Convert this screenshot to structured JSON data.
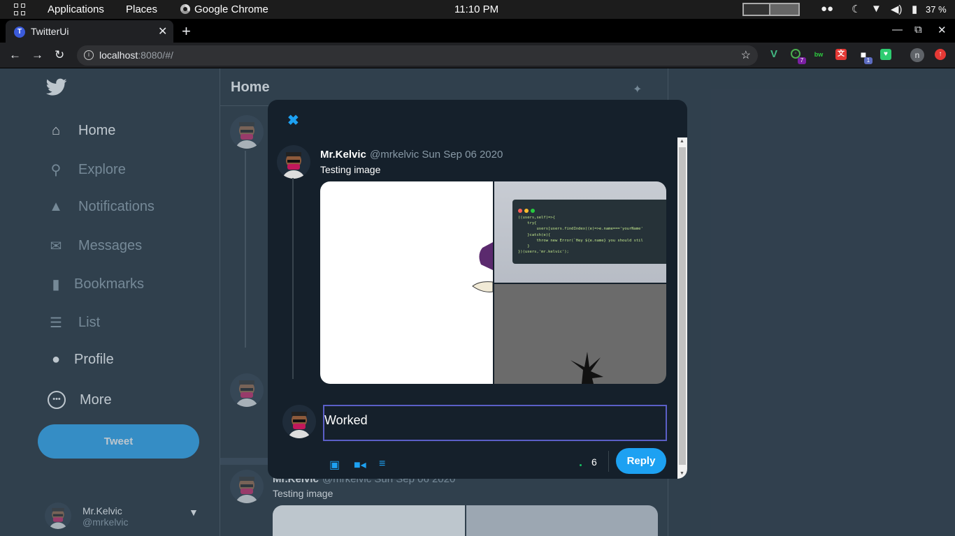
{
  "system_bar": {
    "applications": "Applications",
    "places": "Places",
    "browser": "Google Chrome",
    "clock": "11:10 PM",
    "battery": "37 %"
  },
  "browser": {
    "tab_title": "TwitterUi",
    "tab_favicon_letter": "T",
    "url_host": "localhost",
    "url_rest": ":8080/#/",
    "ext_badge_1": "7",
    "ext_badge_2": "1",
    "profile_letter": "n"
  },
  "sidebar": {
    "items": [
      {
        "label": "Home",
        "icon": "home-icon"
      },
      {
        "label": "Explore",
        "icon": "search-icon"
      },
      {
        "label": "Notifications",
        "icon": "bell-icon"
      },
      {
        "label": "Messages",
        "icon": "envelope-icon"
      },
      {
        "label": "Bookmarks",
        "icon": "bookmark-icon"
      },
      {
        "label": "List",
        "icon": "list-icon"
      },
      {
        "label": "Profile",
        "icon": "user-icon"
      },
      {
        "label": "More",
        "icon": "more-icon"
      }
    ],
    "tweet_button": "Tweet",
    "account_name": "Mr.Kelvic",
    "account_handle": "@mrkelvic"
  },
  "feed": {
    "title": "Home",
    "bg_tweet": {
      "name": "Mr.Kelvic",
      "handle_date": "@mrkelvic Sun Sep 06 2020",
      "text": "Testing image"
    }
  },
  "modal": {
    "tweet": {
      "name": "Mr.Kelvic",
      "handle_date": "@mrkelvic Sun Sep 06 2020",
      "text": "Testing image"
    },
    "reply_input_value": "Worked",
    "char_count": "6",
    "reply_button": "Reply"
  },
  "colors": {
    "accent": "#1da1f2",
    "background": "#15202b",
    "muted": "#8899a6"
  }
}
